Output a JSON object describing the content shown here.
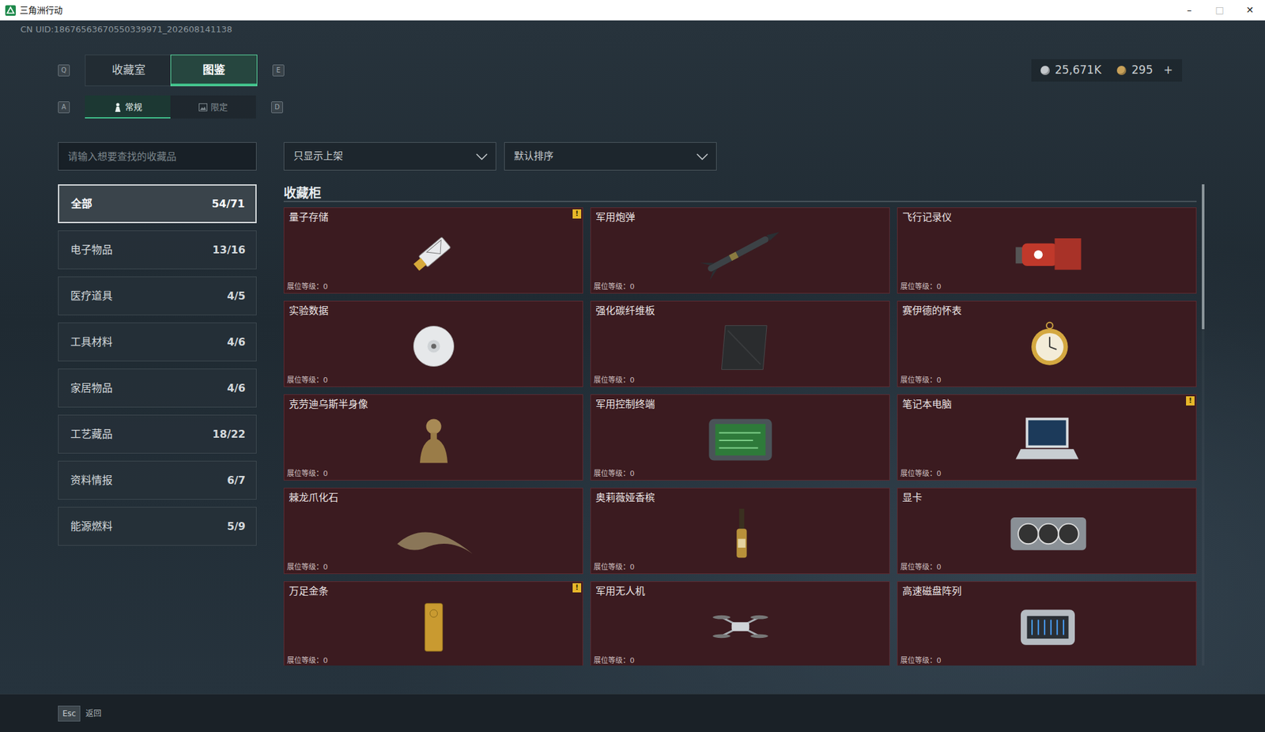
{
  "window": {
    "title": "三角洲行动",
    "controls": [
      {
        "glyph": "–",
        "disabled": false
      },
      {
        "glyph": "□",
        "disabled": true
      },
      {
        "glyph": "✕",
        "disabled": false
      }
    ]
  },
  "uid": "CN UID:18676563670550339971_202608141138",
  "currency": {
    "balances": [
      {
        "amount": "25,671K",
        "color": "#c3c7cb"
      },
      {
        "amount": "295",
        "color": "#c9a25a"
      }
    ],
    "add_button": "+"
  },
  "main_tabs": {
    "prev_key": "Q",
    "next_key": "E",
    "items": [
      {
        "label": "收藏室",
        "selected": false
      },
      {
        "label": "图鉴",
        "selected": true
      }
    ]
  },
  "sub_tabs": {
    "prev_key": "A",
    "next_key": "D",
    "items": [
      {
        "label": "常规",
        "selected": true
      },
      {
        "label": "限定",
        "selected": false
      }
    ]
  },
  "search": {
    "placeholder": "请输入想要查找的收藏品"
  },
  "filters": [
    "只显示上架",
    "默认排序"
  ],
  "categories": [
    {
      "label": "全部",
      "count": "54/71",
      "selected": true
    },
    {
      "label": "电子物品",
      "count": "13/16",
      "selected": false
    },
    {
      "label": "医疗道具",
      "count": "4/5",
      "selected": false
    },
    {
      "label": "工具材料",
      "count": "4/6",
      "selected": false
    },
    {
      "label": "家居物品",
      "count": "4/6",
      "selected": false
    },
    {
      "label": "工艺藏品",
      "count": "18/22",
      "selected": false
    },
    {
      "label": "资料情报",
      "count": "6/7",
      "selected": false
    },
    {
      "label": "能源燃料",
      "count": "5/9",
      "selected": false
    }
  ],
  "collection": {
    "title": "收藏柜",
    "warning_glyph": "!",
    "items": [
      {
        "name": "量子存储",
        "level_label": "展位等级：0",
        "warning": true
      },
      {
        "name": "军用炮弹",
        "level_label": "展位等级：0",
        "warning": false
      },
      {
        "name": "飞行记录仪",
        "level_label": "展位等级：0",
        "warning": false
      },
      {
        "name": "实验数据",
        "level_label": "展位等级：0",
        "warning": false
      },
      {
        "name": "强化碳纤维板",
        "level_label": "展位等级：0",
        "warning": false
      },
      {
        "name": "赛伊德的怀表",
        "level_label": "展位等级：0",
        "warning": false
      },
      {
        "name": "克劳迪乌斯半身像",
        "level_label": "展位等级：0",
        "warning": false
      },
      {
        "name": "军用控制终端",
        "level_label": "展位等级：0",
        "warning": false
      },
      {
        "name": "笔记本电脑",
        "level_label": "展位等级：0",
        "warning": true
      },
      {
        "name": "棘龙爪化石",
        "level_label": "展位等级：0",
        "warning": false
      },
      {
        "name": "奥莉薇娅香槟",
        "level_label": "展位等级：0",
        "warning": false
      },
      {
        "name": "显卡",
        "level_label": "展位等级：0",
        "warning": false
      },
      {
        "name": "万足金条",
        "level_label": "展位等级：0",
        "warning": true
      },
      {
        "name": "军用无人机",
        "level_label": "展位等级：0",
        "warning": false
      },
      {
        "name": "高速磁盘阵列",
        "level_label": "展位等级：0",
        "warning": false
      }
    ]
  },
  "footer": {
    "key": "Esc",
    "label": "返回"
  }
}
